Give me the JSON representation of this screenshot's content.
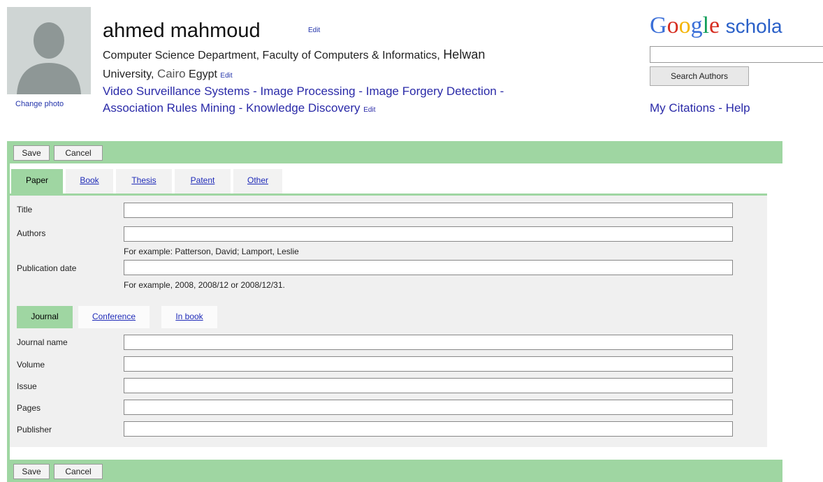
{
  "profile": {
    "name": "ahmed mahmoud",
    "name_edit": "Edit",
    "affiliation_part1": "Computer Science Department, Faculty of Computers & Informatics,",
    "affiliation_part2": "Helwan",
    "affiliation_part3": "University,",
    "affiliation_city": "Cairo",
    "affiliation_country": "Egypt",
    "affiliation_edit": "Edit",
    "interests": [
      "Video Surveillance Systems",
      "Image Processing",
      "Image Forgery Detection",
      "Association Rules Mining",
      "Knowledge Discovery"
    ],
    "interests_separator": "-",
    "interests_edit": "Edit",
    "change_photo": "Change photo"
  },
  "scholar": {
    "logo_text": "Google",
    "logo_word": "schola",
    "search_value": "",
    "search_button": "Search Authors",
    "links": [
      "My Citations",
      "Help"
    ],
    "links_separator": "-"
  },
  "toolbar": {
    "save_label": "Save",
    "cancel_label": "Cancel"
  },
  "type_tabs": [
    {
      "label": "Paper",
      "active": true
    },
    {
      "label": "Book",
      "active": false
    },
    {
      "label": "Thesis",
      "active": false
    },
    {
      "label": "Patent",
      "active": false
    },
    {
      "label": "Other",
      "active": false
    }
  ],
  "fields": {
    "title": {
      "label": "Title",
      "value": ""
    },
    "authors": {
      "label": "Authors",
      "value": "",
      "hint": "For example: Patterson, David; Lamport, Leslie"
    },
    "publication_date": {
      "label": "Publication date",
      "value": "",
      "hint": "For example, 2008, 2008/12 or 2008/12/31."
    }
  },
  "venue_tabs": [
    {
      "label": "Journal",
      "active": true
    },
    {
      "label": "Conference",
      "active": false
    },
    {
      "label": "In book",
      "active": false
    }
  ],
  "journal_fields": {
    "journal_name": {
      "label": "Journal name",
      "value": ""
    },
    "volume": {
      "label": "Volume",
      "value": ""
    },
    "issue": {
      "label": "Issue",
      "value": ""
    },
    "pages": {
      "label": "Pages",
      "value": ""
    },
    "publisher": {
      "label": "Publisher",
      "value": ""
    }
  },
  "colors": {
    "accent_green": "#9fd6a2",
    "link_blue": "#2a2aa8",
    "panel_gray": "#f0f0f0"
  },
  "logo_colors": [
    "#3b6fd8",
    "#d62d20",
    "#f4b400",
    "#3b6fd8",
    "#109d58",
    "#d62d20"
  ]
}
